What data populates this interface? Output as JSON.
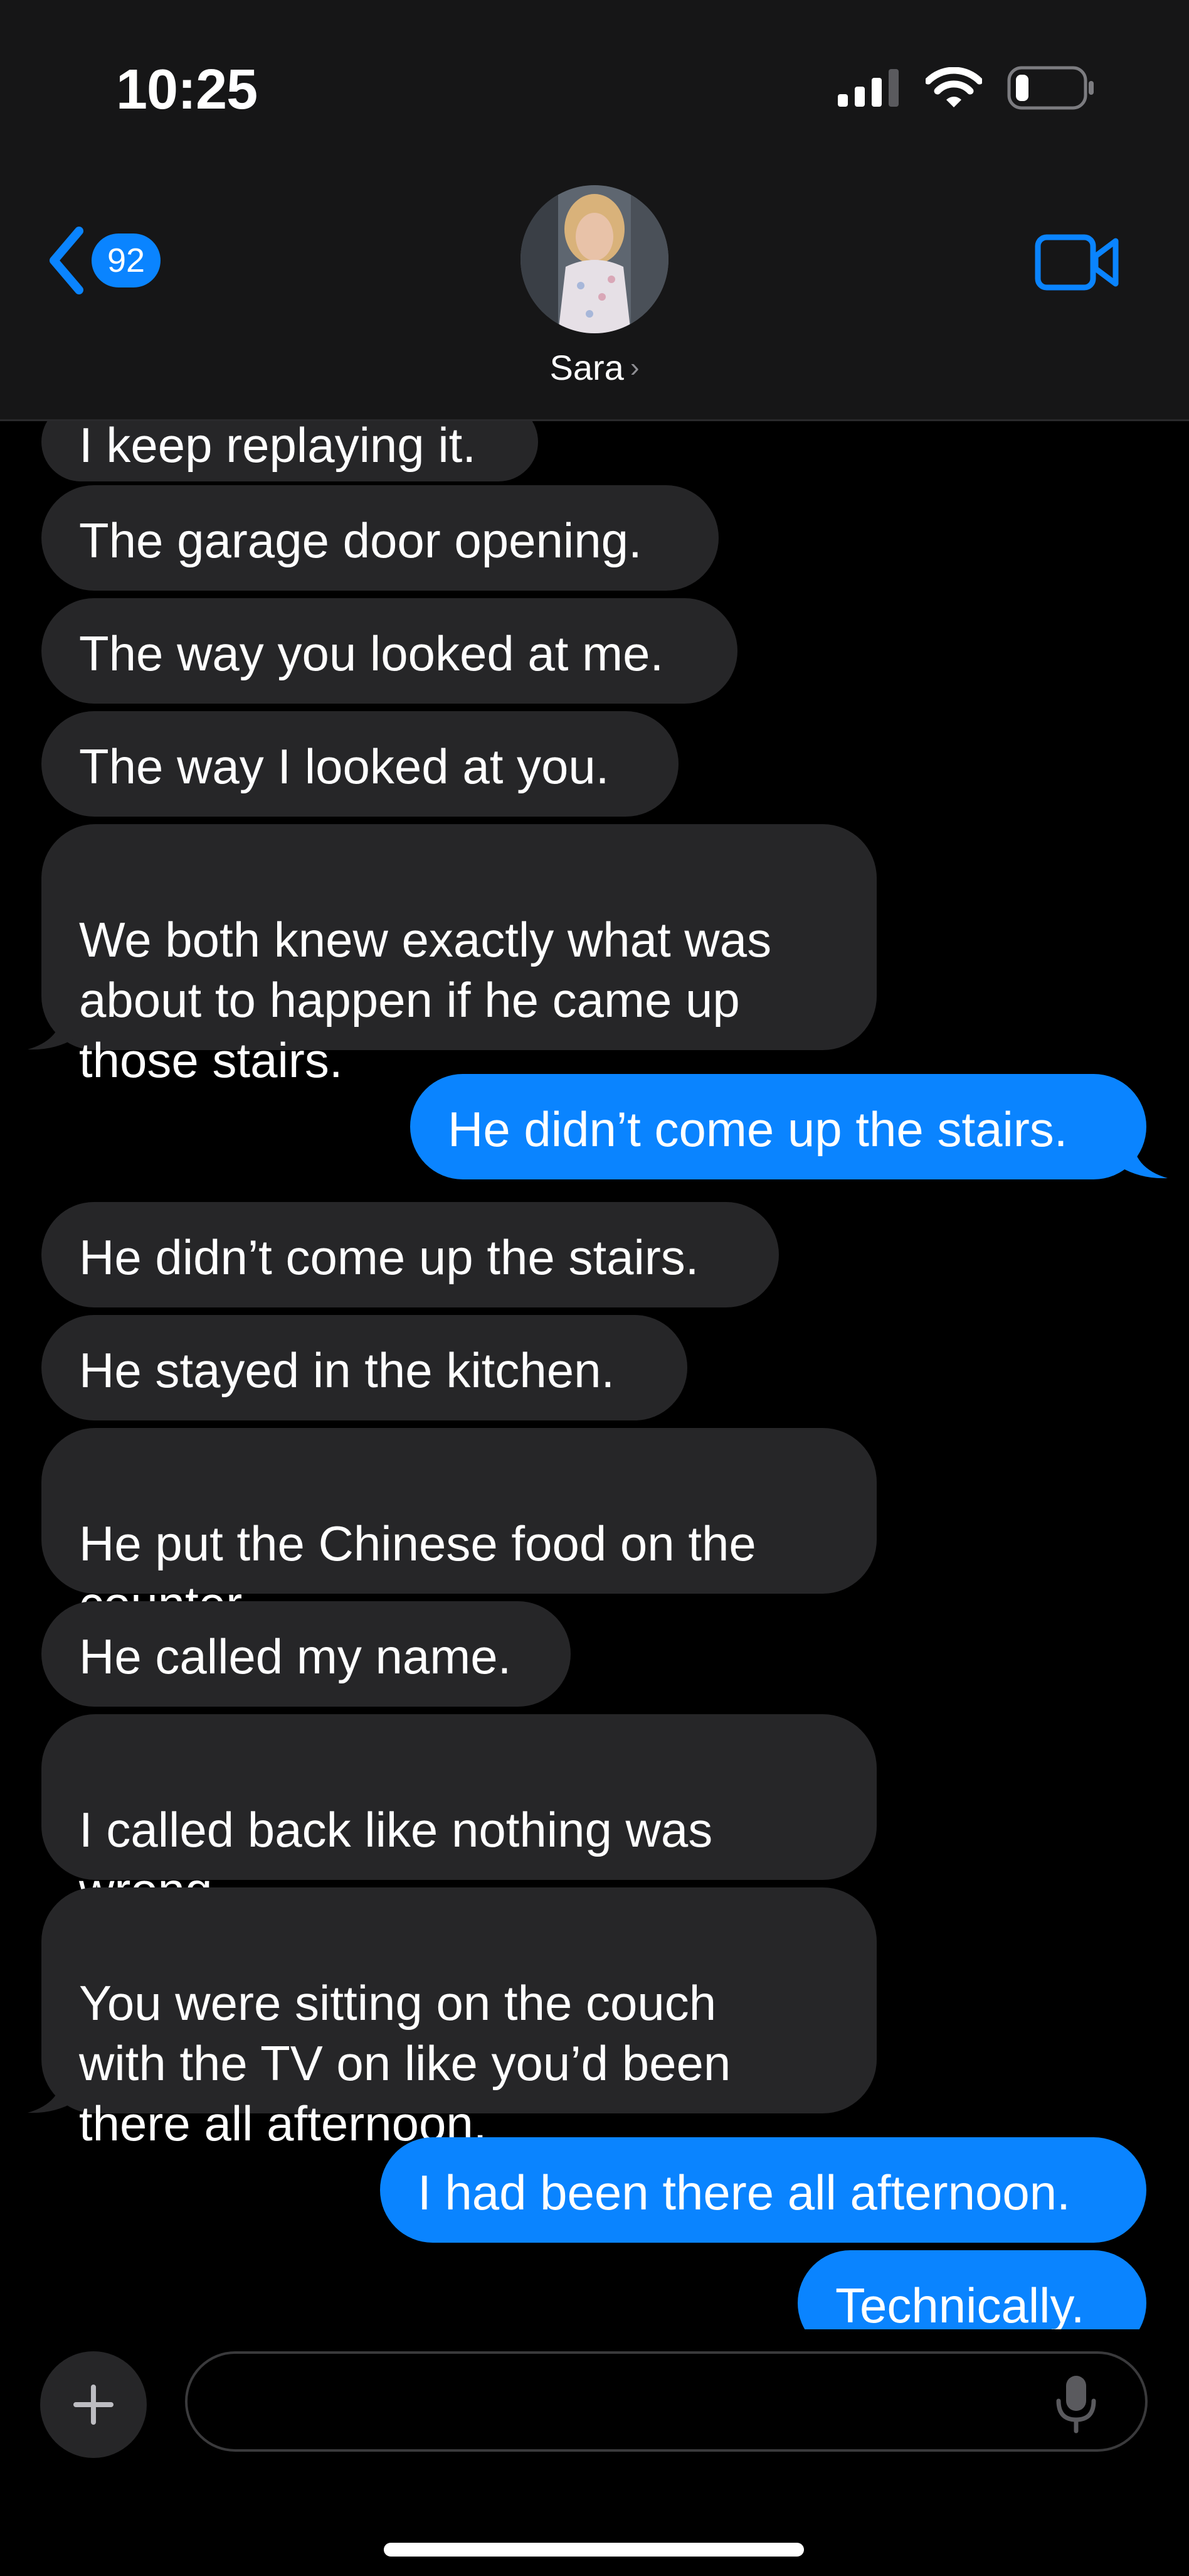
{
  "status_bar": {
    "time": "10:25",
    "icons": [
      "signal-icon",
      "wifi-icon",
      "battery-icon"
    ]
  },
  "header": {
    "back_badge": "92",
    "contact_name": "Sara",
    "icons": [
      "back-chevron-icon",
      "video-call-icon",
      "chevron-right-icon"
    ]
  },
  "messages": [
    {
      "side": "in",
      "text": "I keep replaying it."
    },
    {
      "side": "in",
      "text": "The garage door opening."
    },
    {
      "side": "in",
      "text": "The way you looked at me."
    },
    {
      "side": "in",
      "text": "The way I looked at you."
    },
    {
      "side": "in",
      "text": "We both knew exactly what was\nabout to happen if he came up\nthose stairs."
    },
    {
      "side": "out",
      "text": "He didn’t come up the stairs."
    },
    {
      "side": "in",
      "text": "He didn’t come up the stairs."
    },
    {
      "side": "in",
      "text": "He stayed in the kitchen."
    },
    {
      "side": "in",
      "text": "He put the Chinese food on the\ncounter."
    },
    {
      "side": "in",
      "text": "He called my name."
    },
    {
      "side": "in",
      "text": "I called back like nothing was\nwrong."
    },
    {
      "side": "in",
      "text": "You were sitting on the couch\nwith the TV on like you’d been\nthere all afternoon."
    },
    {
      "side": "out",
      "text": "I had been there all afternoon."
    },
    {
      "side": "out",
      "text": "Technically."
    }
  ],
  "input_bar": {
    "placeholder": "",
    "icons": [
      "plus-icon",
      "microphone-icon"
    ]
  },
  "colors": {
    "accent": "#0a84ff",
    "incoming_bubble": "#262628",
    "header_bg": "#161617",
    "background": "#000000"
  }
}
